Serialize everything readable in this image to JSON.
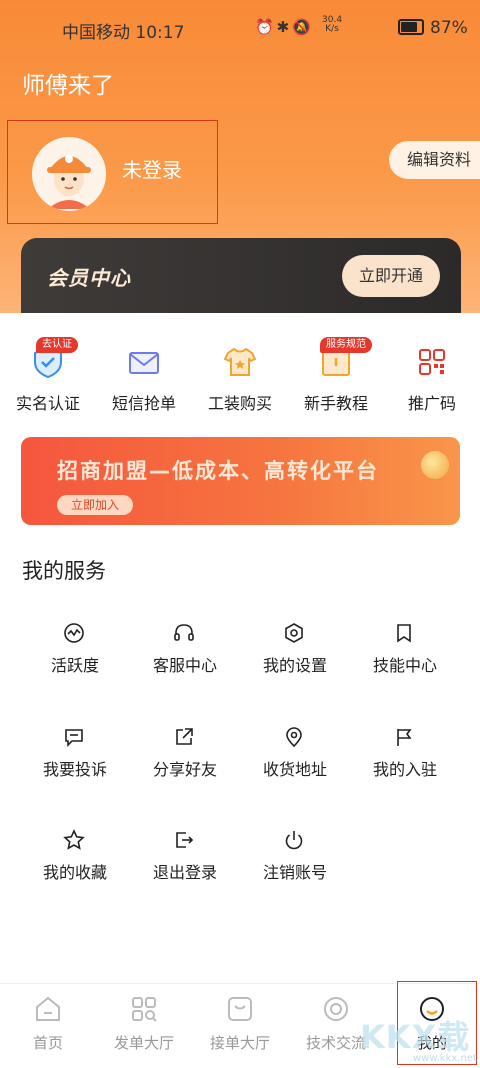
{
  "status_bar": {
    "carrier_time": "中国移动 10:17",
    "speed_value": "30.4",
    "speed_unit": "K/s",
    "battery": "87%"
  },
  "app_title": "师傅来了",
  "profile": {
    "login_status": "未登录",
    "edit_label": "编辑资料"
  },
  "vip": {
    "title": "会员中心",
    "button": "立即开通"
  },
  "quick_actions": [
    {
      "label": "实名认证",
      "badge": "去认证",
      "icon": "shield-check-icon"
    },
    {
      "label": "短信抢单",
      "badge": "",
      "icon": "envelope-icon"
    },
    {
      "label": "工装购买",
      "badge": "",
      "icon": "shirt-icon"
    },
    {
      "label": "新手教程",
      "badge": "服务规范",
      "icon": "book-icon"
    },
    {
      "label": "推广码",
      "badge": "",
      "icon": "qr-code-icon"
    }
  ],
  "banner": {
    "text": "招商加盟—低成本、高转化平台",
    "button": "立即加入"
  },
  "services_title": "我的服务",
  "services": [
    {
      "label": "活跃度",
      "icon": "activity-icon"
    },
    {
      "label": "客服中心",
      "icon": "headset-icon"
    },
    {
      "label": "我的设置",
      "icon": "settings-hexagon-icon"
    },
    {
      "label": "技能中心",
      "icon": "bookmark-icon"
    },
    {
      "label": "我要投诉",
      "icon": "chat-bubble-icon"
    },
    {
      "label": "分享好友",
      "icon": "share-icon"
    },
    {
      "label": "收货地址",
      "icon": "location-pin-icon"
    },
    {
      "label": "我的入驻",
      "icon": "flag-icon"
    },
    {
      "label": "我的收藏",
      "icon": "star-icon"
    },
    {
      "label": "退出登录",
      "icon": "logout-icon"
    },
    {
      "label": "注销账号",
      "icon": "power-icon"
    }
  ],
  "tabs": [
    {
      "label": "首页",
      "icon": "home-icon"
    },
    {
      "label": "发单大厅",
      "icon": "grid-search-icon"
    },
    {
      "label": "接单大厅",
      "icon": "inbox-icon"
    },
    {
      "label": "技术交流",
      "icon": "target-icon"
    },
    {
      "label": "我的",
      "icon": "profile-smile-icon"
    }
  ],
  "watermark": {
    "text": "KKX载",
    "url": "www.kkx.net"
  },
  "colors": {
    "brand_orange": "#f88a37",
    "badge_red": "#e5372c",
    "vip_dark": "#3f3b39",
    "highlight_red": "#d9361e"
  }
}
